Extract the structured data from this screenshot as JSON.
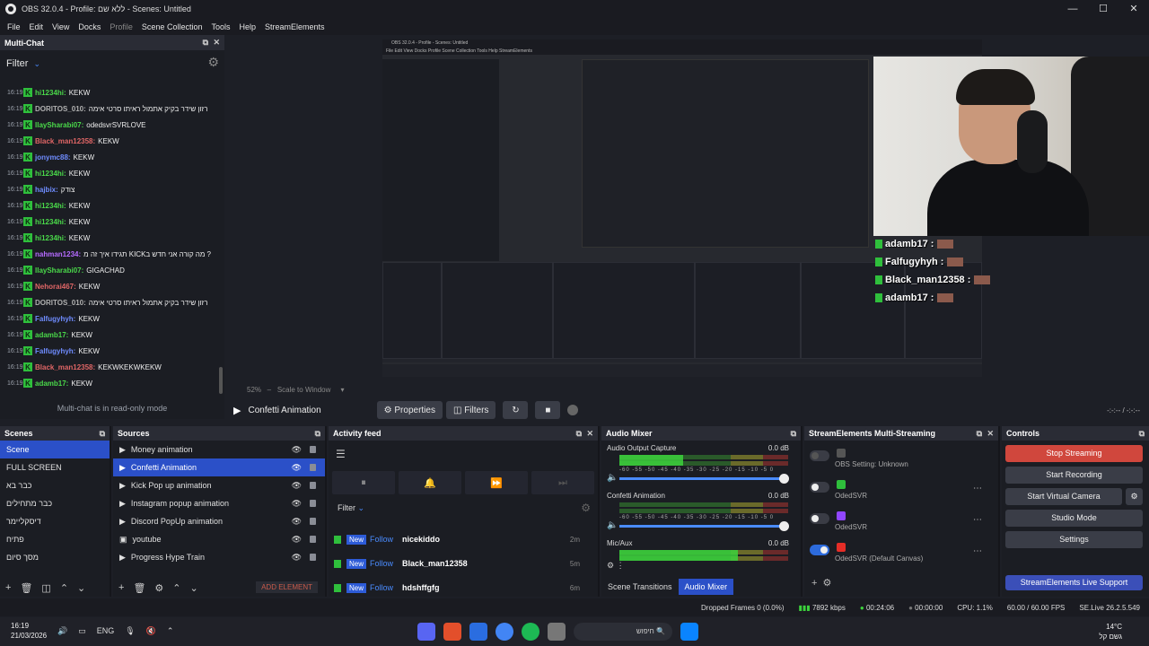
{
  "window": {
    "title": "OBS 32.0.4 - Profile: ללא שם - Scenes: Untitled",
    "min": "—",
    "max": "☐",
    "close": "✕"
  },
  "menu": [
    "File",
    "Edit",
    "View",
    "Docks",
    "Profile",
    "Scene Collection",
    "Tools",
    "Help",
    "StreamElements"
  ],
  "multichat": {
    "title": "Multi-Chat",
    "filter_label": "Filter",
    "readonly": "Multi-chat is in read-only mode",
    "messages": [
      {
        "time": "16:19",
        "user": "hi1234hi:",
        "text": "KEKW",
        "color": "#4ad94a"
      },
      {
        "time": "16:19",
        "user": "DORITOS_010:",
        "text": "רזון שידר בקיק אתמול ראיתו סרטי אימה",
        "color": "#b0b0b0"
      },
      {
        "time": "16:19",
        "user": "llaySharabi07:",
        "text": "odedsvrSVRLOVE",
        "color": "#4ad94a"
      },
      {
        "time": "16:19",
        "user": "Black_man12358:",
        "text": "KEKW",
        "color": "#e06666"
      },
      {
        "time": "16:19",
        "user": "jonymc88:",
        "text": "KEKW",
        "color": "#6f8cff"
      },
      {
        "time": "16:19",
        "user": "hi1234hi:",
        "text": "KEKW",
        "color": "#4ad94a"
      },
      {
        "time": "16:19",
        "user": "hajbix:",
        "text": "צודק",
        "color": "#6f8cff"
      },
      {
        "time": "16:19",
        "user": "hi1234hi:",
        "text": "KEKW",
        "color": "#4ad94a"
      },
      {
        "time": "16:19",
        "user": "hi1234hi:",
        "text": "KEKW",
        "color": "#4ad94a"
      },
      {
        "time": "16:19",
        "user": "hi1234hi:",
        "text": "KEKW",
        "color": "#4ad94a"
      },
      {
        "time": "16:19",
        "user": "nahman1234:",
        "text": "תגידו איך זה מ KICKמה קורה אני חדש ב ?",
        "color": "#b56bff"
      },
      {
        "time": "16:19",
        "user": "llaySharabi07:",
        "text": "GIGACHAD",
        "color": "#4ad94a"
      },
      {
        "time": "16:19",
        "user": "Nehorai467:",
        "text": "KEKW",
        "color": "#e06666"
      },
      {
        "time": "16:19",
        "user": "DORITOS_010:",
        "text": "רזון שידר בקיק אתמול ראיתו סרטי אימה",
        "color": "#b0b0b0"
      },
      {
        "time": "16:19",
        "user": "Falfugyhyh:",
        "text": "KEKW",
        "color": "#6f8cff"
      },
      {
        "time": "16:19",
        "user": "adamb17:",
        "text": "KEKW",
        "color": "#4ad94a"
      },
      {
        "time": "16:19",
        "user": "Falfugyhyh:",
        "text": "KEKW",
        "color": "#6f8cff"
      },
      {
        "time": "16:19",
        "user": "Black_man12358:",
        "text": "KEKWKEKWKEKW",
        "color": "#e06666"
      },
      {
        "time": "16:19",
        "user": "adamb17:",
        "text": "KEKW",
        "color": "#4ad94a"
      }
    ]
  },
  "overlay": [
    "adamb17 :",
    "Falfugyhyh :",
    "Black_man12358 :",
    "adamb17 :"
  ],
  "zoom": {
    "percent": "52%",
    "mode": "Scale to Window"
  },
  "controlbar": {
    "scene": "Confetti Animation",
    "properties": "Properties",
    "filters": "Filters",
    "time": "-:-:-- / -:-:--"
  },
  "scenes": {
    "title": "Scenes",
    "items": [
      "Scene",
      "FULL SCREEN",
      "כבר בא",
      "כבר מתחילים",
      "דיסקליימר",
      "פתיח",
      "מסך סיום"
    ],
    "selected": 0
  },
  "sources": {
    "title": "Sources",
    "items": [
      "Money animation",
      "Confetti Animation",
      "Kick Pop up animation",
      "Instagram popup animation",
      "Discord PopUp animation",
      "youtube",
      "Progress Hype Train"
    ],
    "selected": 1,
    "add_element": "ADD ELEMENT"
  },
  "activity": {
    "title": "Activity feed",
    "filter": "Filter",
    "rows": [
      {
        "new": "New",
        "follow": "Follow",
        "name": "nicekiddo",
        "time": "2m"
      },
      {
        "new": "New",
        "follow": "Follow",
        "name": "Black_man12358",
        "time": "5m"
      },
      {
        "new": "New",
        "follow": "Follow",
        "name": "hdshffgfg",
        "time": "6m"
      }
    ]
  },
  "mixer": {
    "title": "Audio Mixer",
    "channels": [
      {
        "name": "Audio Output Capture",
        "db": "0.0 dB",
        "level": 0.38
      },
      {
        "name": "Confetti Animation",
        "db": "0.0 dB",
        "level": 0
      },
      {
        "name": "Mic/Aux",
        "db": "0.0 dB",
        "level": 0.7
      }
    ],
    "scale": "-60 -55 -50 -45 -40 -35 -30 -25 -20 -15 -10 -5 0",
    "tab_transitions": "Scene Transitions",
    "tab_mixer": "Audio Mixer"
  },
  "multistream": {
    "title": "StreamElements Multi-Streaming",
    "rows": [
      {
        "name": "OBS Setting: Unknown",
        "on": false,
        "icon": "#555"
      },
      {
        "name": "OdedSVR",
        "on": false,
        "icon": "#2fbf3c"
      },
      {
        "name": "OdedSVR",
        "on": false,
        "icon": "#9146ff"
      },
      {
        "name": "OdedSVR (Default Canvas)",
        "on": true,
        "icon": "#e52d27"
      }
    ]
  },
  "controls": {
    "title": "Controls",
    "stop_streaming": "Stop Streaming",
    "start_recording": "Start Recording",
    "start_virtual_camera": "Start Virtual Camera",
    "studio_mode": "Studio Mode",
    "settings": "Settings",
    "live_support": "StreamElements Live Support"
  },
  "status": {
    "dropped": "Dropped Frames 0 (0.0%)",
    "kbps": "7892 kbps",
    "live_time": "00:24:06",
    "rec_time": "00:00:00",
    "cpu": "CPU: 1.1%",
    "fps": "60.00 / 60.00 FPS",
    "version": "SE.Live 26.2.5.549"
  },
  "taskbar": {
    "time": "16:19",
    "date": "21/03/2026",
    "lang": "ENG",
    "search": "חיפוש",
    "temp": "14°C",
    "weather": "גשם קל"
  },
  "colors": {
    "accent": "#2b50c8",
    "stop": "#d0473d",
    "kick": "#2fbf3c"
  }
}
